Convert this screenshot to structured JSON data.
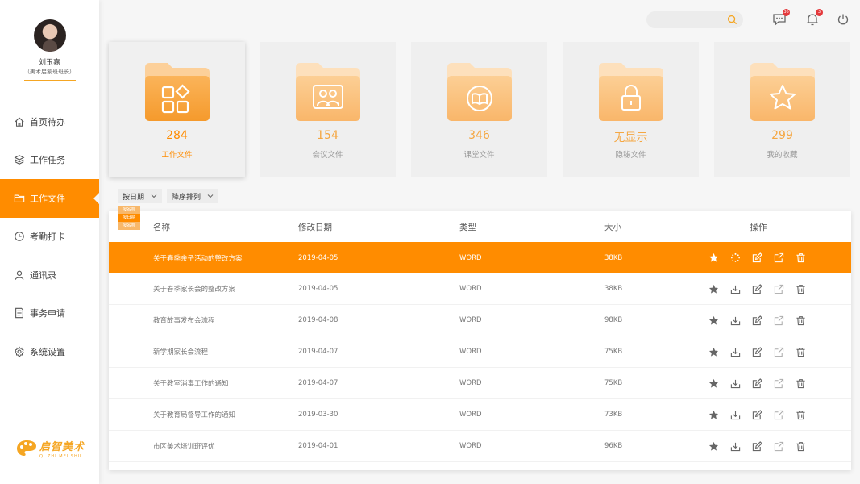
{
  "user": {
    "name": "刘玉嘉",
    "role": "（美术启蒙班班长）"
  },
  "nav": [
    {
      "label": "首页待办",
      "icon": "home-icon",
      "active": false
    },
    {
      "label": "工作任务",
      "icon": "layers-icon",
      "active": false
    },
    {
      "label": "工作文件",
      "icon": "folder-icon",
      "active": true
    },
    {
      "label": "考勤打卡",
      "icon": "clock-icon",
      "active": false
    },
    {
      "label": "通讯录",
      "icon": "user-icon",
      "active": false
    },
    {
      "label": "事务申请",
      "icon": "document-icon",
      "active": false
    },
    {
      "label": "系统设置",
      "icon": "gear-icon",
      "active": false
    }
  ],
  "logo": {
    "text": "启智美术",
    "pinyin": "QI ZHI MEI SHU"
  },
  "header": {
    "search": {
      "placeholder": ""
    },
    "message_badge": "36",
    "notification_badge": "3"
  },
  "cards": [
    {
      "count": "284",
      "label": "工作文件",
      "icon": "apps-icon",
      "active": true
    },
    {
      "count": "154",
      "label": "会议文件",
      "icon": "meeting-icon",
      "active": false
    },
    {
      "count": "346",
      "label": "课堂文件",
      "icon": "book-icon",
      "active": false
    },
    {
      "count": "无显示",
      "label": "隐秘文件",
      "icon": "lock-icon",
      "active": false
    },
    {
      "count": "299",
      "label": "我的收藏",
      "icon": "star-icon",
      "active": false
    }
  ],
  "filters": {
    "by_date": "按日期",
    "sort_order": "降序排列",
    "sort_options": [
      "按名称",
      "按日期",
      "按名称"
    ]
  },
  "table": {
    "columns": [
      "名称",
      "修改日期",
      "类型",
      "大小",
      "操作"
    ],
    "rows": [
      {
        "name": "关于春季亲子活动的整改方案",
        "date": "2019-04-05",
        "type": "WORD",
        "size": "38KB",
        "selected": true
      },
      {
        "name": "关于春季家长会的整改方案",
        "date": "2019-04-05",
        "type": "WORD",
        "size": "38KB",
        "selected": false
      },
      {
        "name": "教育故事发布会流程",
        "date": "2019-04-08",
        "type": "WORD",
        "size": "98KB",
        "selected": false
      },
      {
        "name": "新学期家长会流程",
        "date": "2019-04-07",
        "type": "WORD",
        "size": "75KB",
        "selected": false
      },
      {
        "name": "关于教室消毒工作的通知",
        "date": "2019-04-07",
        "type": "WORD",
        "size": "75KB",
        "selected": false
      },
      {
        "name": "关于教育局督导工作的通知",
        "date": "2019-03-30",
        "type": "WORD",
        "size": "73KB",
        "selected": false
      },
      {
        "name": "市区美术培训班评优",
        "date": "2019-04-01",
        "type": "WORD",
        "size": "96KB",
        "selected": false
      }
    ]
  },
  "colors": {
    "accent": "#ff8c00",
    "accent_light": "#f5a742",
    "background": "#f6f6f6"
  }
}
